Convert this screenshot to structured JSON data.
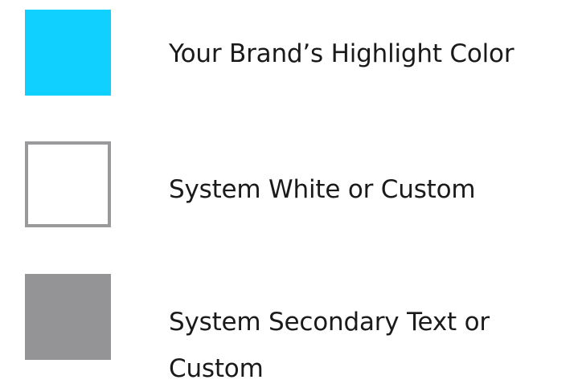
{
  "legend": {
    "items": [
      {
        "color": "#10D0FF",
        "border": null,
        "label": "Your Brand’s Highlight Color"
      },
      {
        "color": "#FFFFFF",
        "border": "#9A9A9C",
        "label": "System White or Custom"
      },
      {
        "color": "#949497",
        "border": null,
        "label": "System Secondary Text or Custom"
      }
    ]
  }
}
